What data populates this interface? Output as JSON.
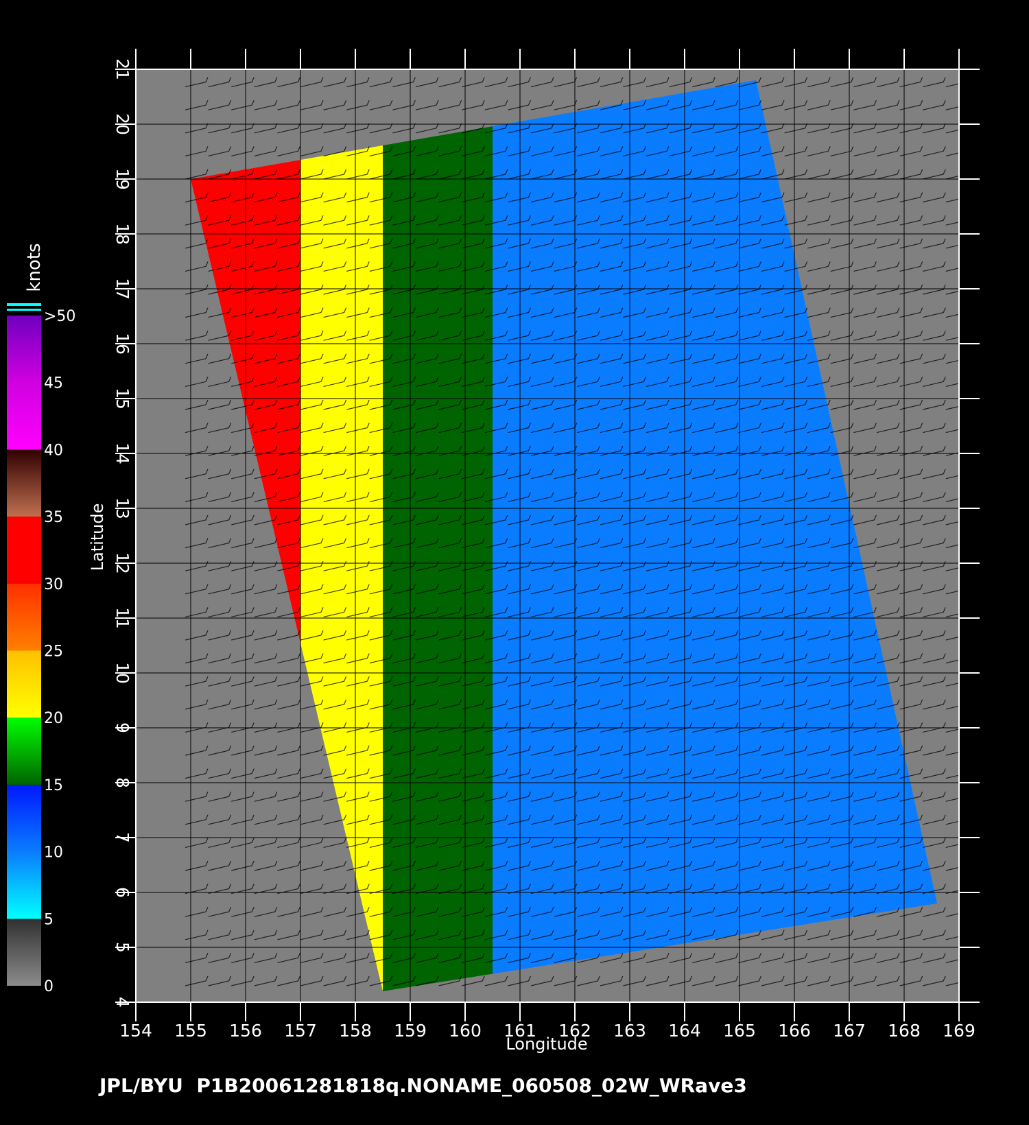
{
  "map": {
    "xlabel": "Longitude",
    "ylabel": "Latitude",
    "x_range": [
      154,
      169
    ],
    "y_range": [
      4,
      21
    ],
    "x_ticks": [
      "154",
      "155",
      "156",
      "157",
      "158",
      "159",
      "160",
      "161",
      "162",
      "163",
      "164",
      "165",
      "166",
      "167",
      "168",
      "169"
    ],
    "y_ticks": [
      "4",
      "5",
      "6",
      "7",
      "8",
      "9",
      "10",
      "11",
      "12",
      "13",
      "14",
      "15",
      "16",
      "17",
      "18",
      "19",
      "20",
      "21"
    ],
    "grid": true,
    "land_color": "#808080",
    "swath_corners_lonlat": [
      [
        155.0,
        19.0
      ],
      [
        165.3,
        20.8
      ],
      [
        168.6,
        5.8
      ],
      [
        158.5,
        4.2
      ]
    ],
    "wind_speed_field_description_bands_knots_by_longitude": [
      {
        "lon_from": 155.0,
        "lon_to": 157.0,
        "speed_range": [
          25,
          35
        ]
      },
      {
        "lon_from": 157.0,
        "lon_to": 158.5,
        "speed_range": [
          20,
          25
        ]
      },
      {
        "lon_from": 158.5,
        "lon_to": 160.5,
        "speed_range": [
          15,
          20
        ]
      },
      {
        "lon_from": 160.5,
        "lon_to": 168.6,
        "speed_range": [
          10,
          15
        ]
      }
    ]
  },
  "colorbar": {
    "unit": "knots",
    "stops": [
      {
        "value": 0,
        "color": "#8c8c8c"
      },
      {
        "value": 5,
        "color": "#303030"
      },
      {
        "value": 5,
        "color": "#00ffff"
      },
      {
        "value": 10,
        "color": "#0a7cff"
      },
      {
        "value": 15,
        "color": "#0018ff"
      },
      {
        "value": 15,
        "color": "#006400"
      },
      {
        "value": 20,
        "color": "#00ff00"
      },
      {
        "value": 20,
        "color": "#ffff00"
      },
      {
        "value": 25,
        "color": "#ffc000"
      },
      {
        "value": 25,
        "color": "#ff8000"
      },
      {
        "value": 30,
        "color": "#ff3000"
      },
      {
        "value": 30,
        "color": "#ff0000"
      },
      {
        "value": 35,
        "color": "#ff0000"
      },
      {
        "value": 35,
        "color": "#c07050"
      },
      {
        "value": 40,
        "color": "#300000"
      },
      {
        "value": 40,
        "color": "#ff00ff"
      },
      {
        "value": 45,
        "color": "#d000e0"
      },
      {
        "value": 50,
        "color": "#7000c0"
      }
    ],
    "labels": [
      "0",
      "5",
      "10",
      "15",
      "20",
      "25",
      "30",
      "35",
      "40",
      "45",
      ">50"
    ]
  },
  "footer": {
    "caption": "JPL/BYU  P1B20061281818q.NONAME_060508_02W_WRave3"
  }
}
